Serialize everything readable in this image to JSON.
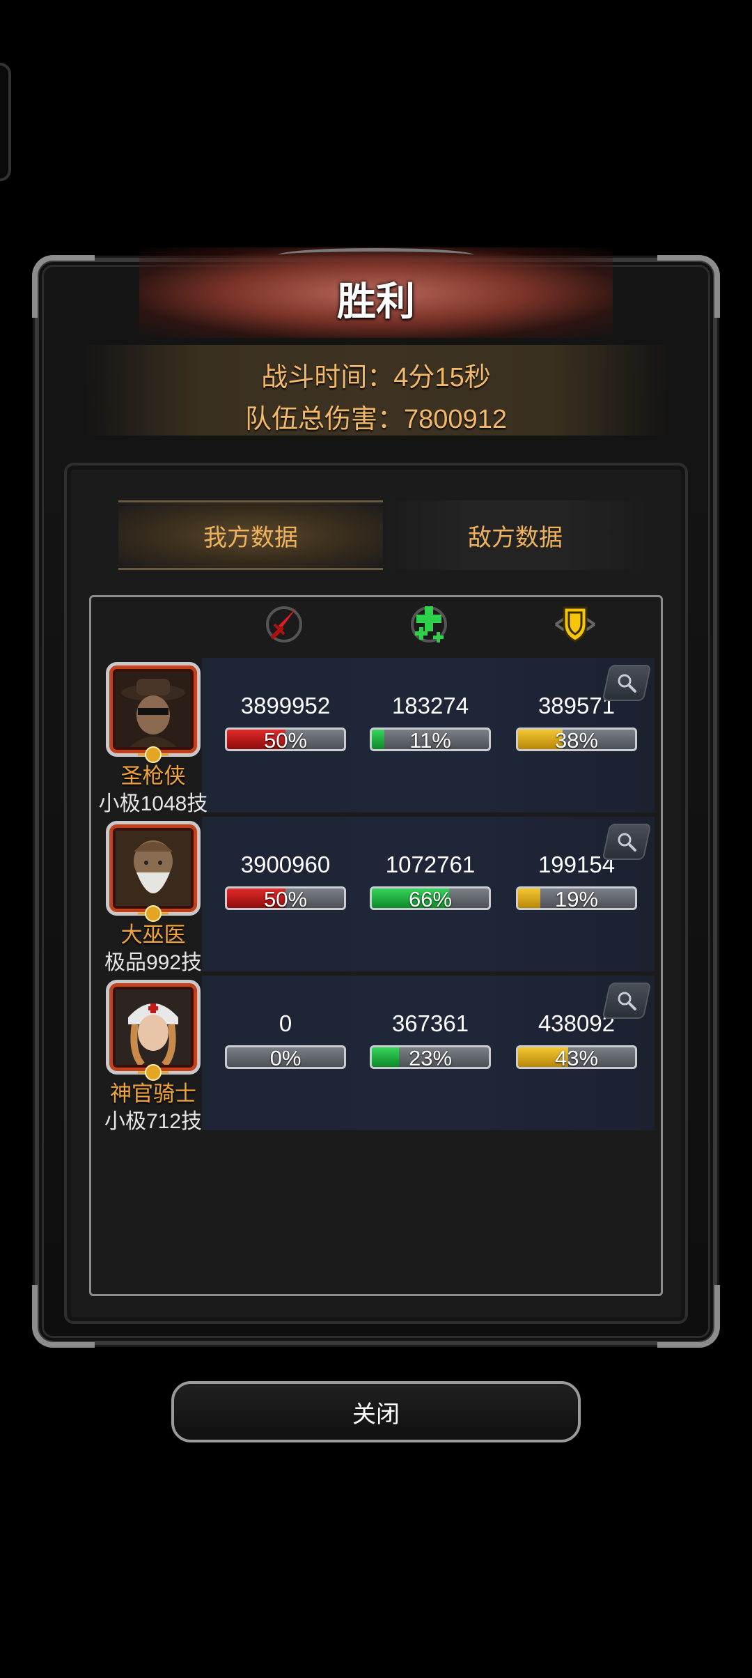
{
  "title": "胜利",
  "battle_time": "战斗时间：4分15秒",
  "team_damage": "队伍总伤害：7800912",
  "tabs": {
    "ours": "我方数据",
    "enemy": "敌方数据"
  },
  "columns": [
    {
      "icon": "red-sword-icon"
    },
    {
      "icon": "green-heal-cross-icon"
    },
    {
      "icon": "gold-shield-icon"
    }
  ],
  "heroes": [
    {
      "name": "圣枪侠",
      "rank": "小极1048技",
      "damage": {
        "value": "3899952",
        "pct_label": "50%",
        "pct": 50
      },
      "heal": {
        "value": "183274",
        "pct_label": "11%",
        "pct": 11
      },
      "tank": {
        "value": "389571",
        "pct_label": "38%",
        "pct": 38
      }
    },
    {
      "name": "大巫医",
      "rank": "极品992技",
      "damage": {
        "value": "3900960",
        "pct_label": "50%",
        "pct": 50
      },
      "heal": {
        "value": "1072761",
        "pct_label": "66%",
        "pct": 66
      },
      "tank": {
        "value": "199154",
        "pct_label": "19%",
        "pct": 19
      }
    },
    {
      "name": "神官骑士",
      "rank": "小极712技",
      "damage": {
        "value": "0",
        "pct_label": "0%",
        "pct": 0
      },
      "heal": {
        "value": "367361",
        "pct_label": "23%",
        "pct": 23
      },
      "tank": {
        "value": "438092",
        "pct_label": "43%",
        "pct": 43
      }
    }
  ],
  "close_label": "关闭",
  "colors": {
    "accent_gold": "#f0b35c",
    "damage": "#c81616",
    "heal": "#1faa3c",
    "tank": "#e0a814"
  }
}
